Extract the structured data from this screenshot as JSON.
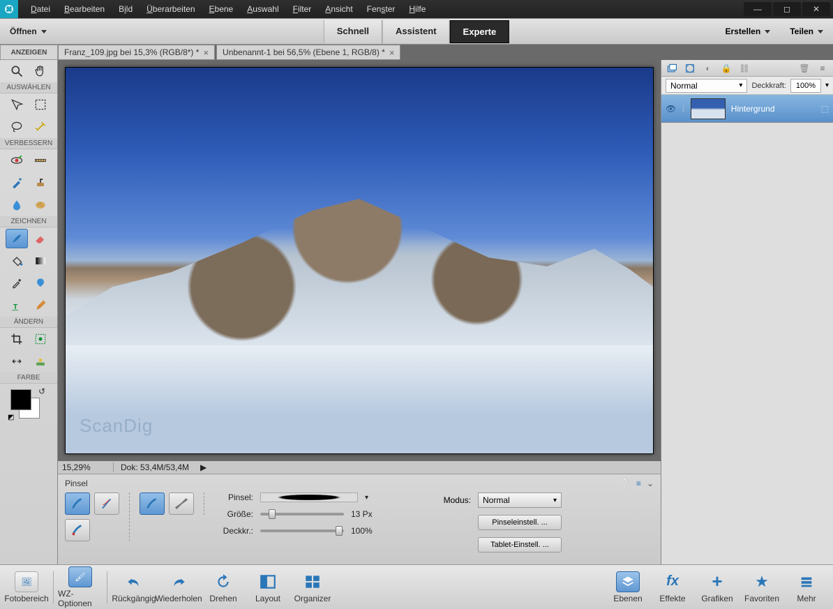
{
  "menubar": {
    "items": [
      "Datei",
      "Bearbeiten",
      "Bild",
      "Überarbeiten",
      "Ebene",
      "Auswahl",
      "Filter",
      "Ansicht",
      "Fenster",
      "Hilfe"
    ]
  },
  "actionbar": {
    "open_label": "Öffnen",
    "modes": {
      "quick": "Schnell",
      "guided": "Assistent",
      "expert": "Experte"
    },
    "create_label": "Erstellen",
    "share_label": "Teilen"
  },
  "toolbox": {
    "section_view": "ANZEIGEN",
    "section_select": "AUSWÄHLEN",
    "section_enhance": "VERBESSERN",
    "section_draw": "ZEICHNEN",
    "section_modify": "ÄNDERN",
    "section_color": "FARBE"
  },
  "doc_tabs": [
    {
      "label": "Franz_109.jpg bei 15,3% (RGB/8*) *"
    },
    {
      "label": "Unbenannt-1 bei 56,5% (Ebene 1, RGB/8) *"
    }
  ],
  "watermark": "ScanDig",
  "statusbar": {
    "zoom": "15,29%",
    "docinfo": "Dok: 53,4M/53,4M"
  },
  "options": {
    "title": "Pinsel",
    "brush_label": "Pinsel:",
    "size_label": "Größe:",
    "size_value": "13 Px",
    "opacity_label": "Deckkr.:",
    "opacity_value": "100%",
    "mode_label": "Modus:",
    "mode_value": "Normal",
    "brush_settings": "Pinseleinstell. ...",
    "tablet_settings": "Tablet-Einstell. ..."
  },
  "layers": {
    "blend_mode": "Normal",
    "opacity_label": "Deckkraft:",
    "opacity_value": "100%",
    "layer_name": "Hintergrund"
  },
  "bottombar": {
    "fotobereich": "Fotobereich",
    "wz": "WZ-Optionen",
    "undo": "Rückgängig",
    "redo": "Wiederholen",
    "rotate": "Drehen",
    "layout": "Layout",
    "organizer": "Organizer",
    "ebenen": "Ebenen",
    "effekte": "Effekte",
    "grafiken": "Grafiken",
    "favoriten": "Favoriten",
    "mehr": "Mehr"
  }
}
